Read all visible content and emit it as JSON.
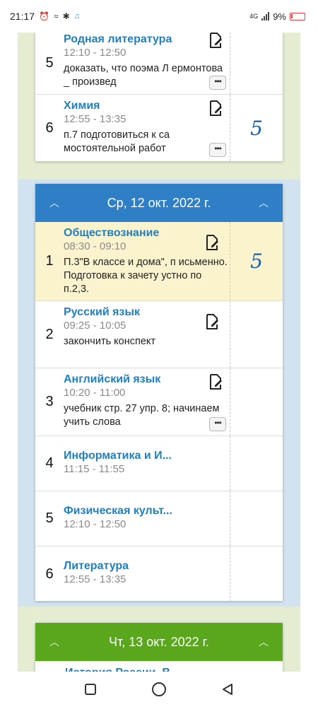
{
  "status": {
    "time": "21:17",
    "network": "4G",
    "battery": "9%"
  },
  "top_card": {
    "lessons": [
      {
        "num": "5",
        "subject": "Родная литература",
        "time": "12:10 - 12:50",
        "hw": "доказать, что поэма Л ермонтова _ произвед",
        "mark": ""
      },
      {
        "num": "6",
        "subject": "Химия",
        "time": "12:55 - 13:35",
        "hw": "п.7 подготовиться к са мостоятельной работ",
        "mark": "5"
      }
    ]
  },
  "wednesday": {
    "title": "Ср, 12 окт. 2022 г.",
    "lessons": [
      {
        "num": "1",
        "subject": "Обществознание",
        "time": "08:30 - 09:10",
        "hw": "П.3\"В классе и дома\", п исьменно. Подготовка к зачету устно по п.2,3.",
        "mark": "5"
      },
      {
        "num": "2",
        "subject": "Русский язык",
        "time": "09:25 - 10:05",
        "hw": "закончить конспект",
        "mark": ""
      },
      {
        "num": "3",
        "subject": "Английский язык",
        "time": "10:20 - 11:00",
        "hw": "учебник стр. 27 упр. 8; начинаем учить слова",
        "mark": ""
      },
      {
        "num": "4",
        "subject": "Информатика и И...",
        "time": "11:15 - 11:55",
        "hw": "",
        "mark": ""
      },
      {
        "num": "5",
        "subject": "Физическая культ...",
        "time": "12:10 - 12:50",
        "hw": "",
        "mark": ""
      },
      {
        "num": "6",
        "subject": "Литература",
        "time": "12:55 - 13:35",
        "hw": "",
        "mark": ""
      }
    ]
  },
  "thursday": {
    "title": "Чт, 13 окт. 2022 г.",
    "first_subject": "История России. В"
  },
  "colors": {
    "blue_header": "#2e7fc6",
    "green_header": "#5aa61c",
    "subject": "#1f7fbf",
    "mark": "#1f5ea8",
    "highlight": "#fbf3cd"
  }
}
